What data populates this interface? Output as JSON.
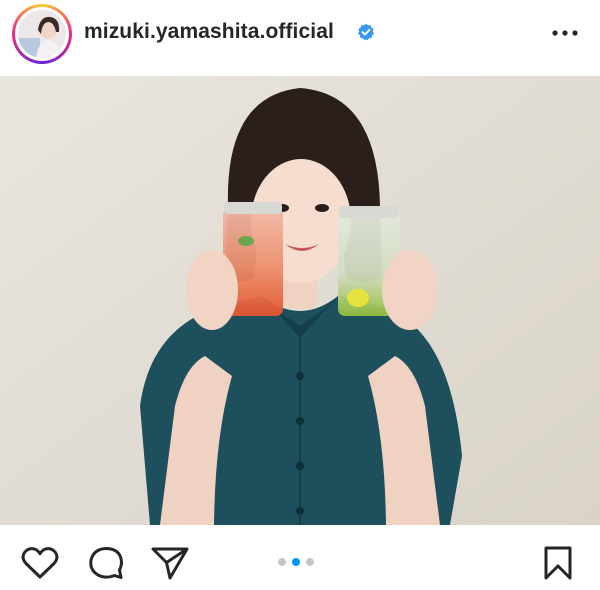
{
  "post": {
    "username": "mizuki.yamashita.official",
    "verified": true,
    "carousel": {
      "current_index": 2,
      "total": 3
    }
  },
  "icons": {
    "more": "more-options-icon",
    "like": "heart-icon",
    "comment": "comment-icon",
    "share": "paper-plane-icon",
    "save": "bookmark-icon"
  },
  "colors": {
    "verified_badge": "#3897f0",
    "active_dot": "#0095f6",
    "inactive_dot": "#c7c7c7",
    "text": "#262626"
  }
}
